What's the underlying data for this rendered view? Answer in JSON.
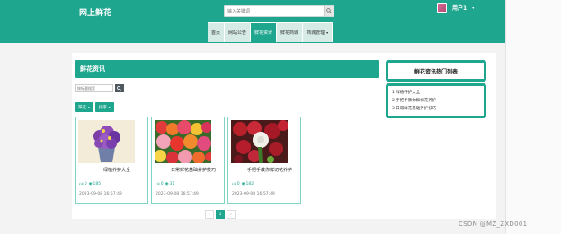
{
  "header": {
    "logo": "网上鲜花",
    "search_placeholder": "输入关键词",
    "user_name": "用户1",
    "nav": [
      {
        "label": "首页",
        "active": false
      },
      {
        "label": "网站公告",
        "active": false
      },
      {
        "label": "鲜花资讯",
        "active": true
      },
      {
        "label": "鲜花商城",
        "active": false
      },
      {
        "label": "商城管理",
        "active": false,
        "has_caret": true
      }
    ]
  },
  "main": {
    "section_title": "鲜花资讯",
    "filter_placeholder": "按标题搜索",
    "sort_buttons": [
      {
        "label": "筛选"
      },
      {
        "label": "排序"
      }
    ],
    "cards": [
      {
        "title": "绿植养护大全",
        "likes": "0",
        "views": "185",
        "time": "2023-09-08 16:57:49"
      },
      {
        "title": "日常鲜花基础养护技巧",
        "likes": "0",
        "views": "31",
        "time": "2023-09-08 16:57:49"
      },
      {
        "title": "手把手教你鲜切花养护",
        "likes": "0",
        "views": "182",
        "time": "2023-09-08 16:57:49"
      }
    ],
    "pagination": {
      "prev": "‹",
      "current": "1",
      "next": "›"
    }
  },
  "sidebar": {
    "title": "鲜花资讯热门列表",
    "items": [
      {
        "label": "1 绿植养护大全"
      },
      {
        "label": "2 手把手教你鲜切花养护"
      },
      {
        "label": "3 日常鲜花基础养护技巧"
      }
    ]
  },
  "watermark": "CSDN @MZ_ZXD001",
  "colors": {
    "accent": "#1fa68e",
    "nav_bg": "#d6ebe6"
  }
}
